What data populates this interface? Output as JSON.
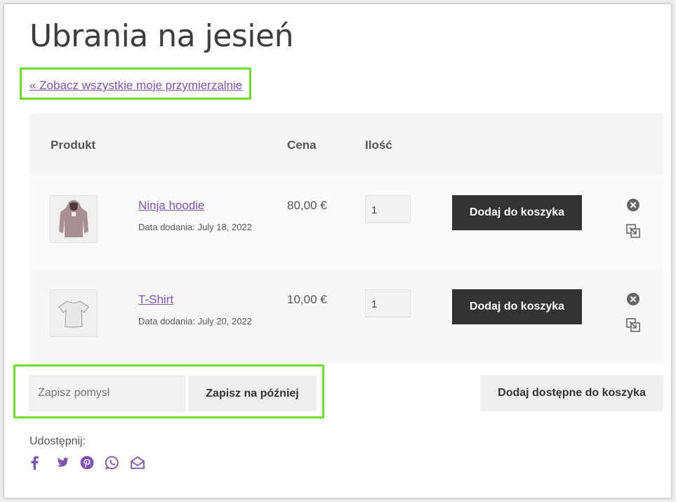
{
  "page": {
    "title": "Ubrania na jesień"
  },
  "back_link": {
    "label": "« Zobacz wszystkie moje przymierzalnie"
  },
  "table": {
    "headers": {
      "product": "Produkt",
      "price": "Cena",
      "quantity": "Ilość"
    },
    "rows": [
      {
        "name": "Ninja hoodie",
        "date": "Data dodania: July 18, 2022",
        "price": "80,00 €",
        "qty": "1",
        "add_label": "Dodaj do koszyka",
        "image_icon": "hoodie-icon"
      },
      {
        "name": "T-Shirt",
        "date": "Data dodania: July 20, 2022",
        "price": "10,00 €",
        "qty": "1",
        "add_label": "Dodaj do koszyka",
        "image_icon": "tshirt-icon"
      }
    ]
  },
  "idea": {
    "placeholder": "Zapisz pomysł",
    "save_label": "Zapisz na później"
  },
  "add_all_label": "Dodaj dostępne do koszyka",
  "share": {
    "label": "Udostępnij:",
    "icons": [
      "facebook-icon",
      "twitter-icon",
      "pinterest-icon",
      "whatsapp-icon",
      "email-icon"
    ]
  },
  "colors": {
    "accent": "#7f54b3",
    "button_dark": "#333333",
    "highlight": "#6ce02c"
  }
}
